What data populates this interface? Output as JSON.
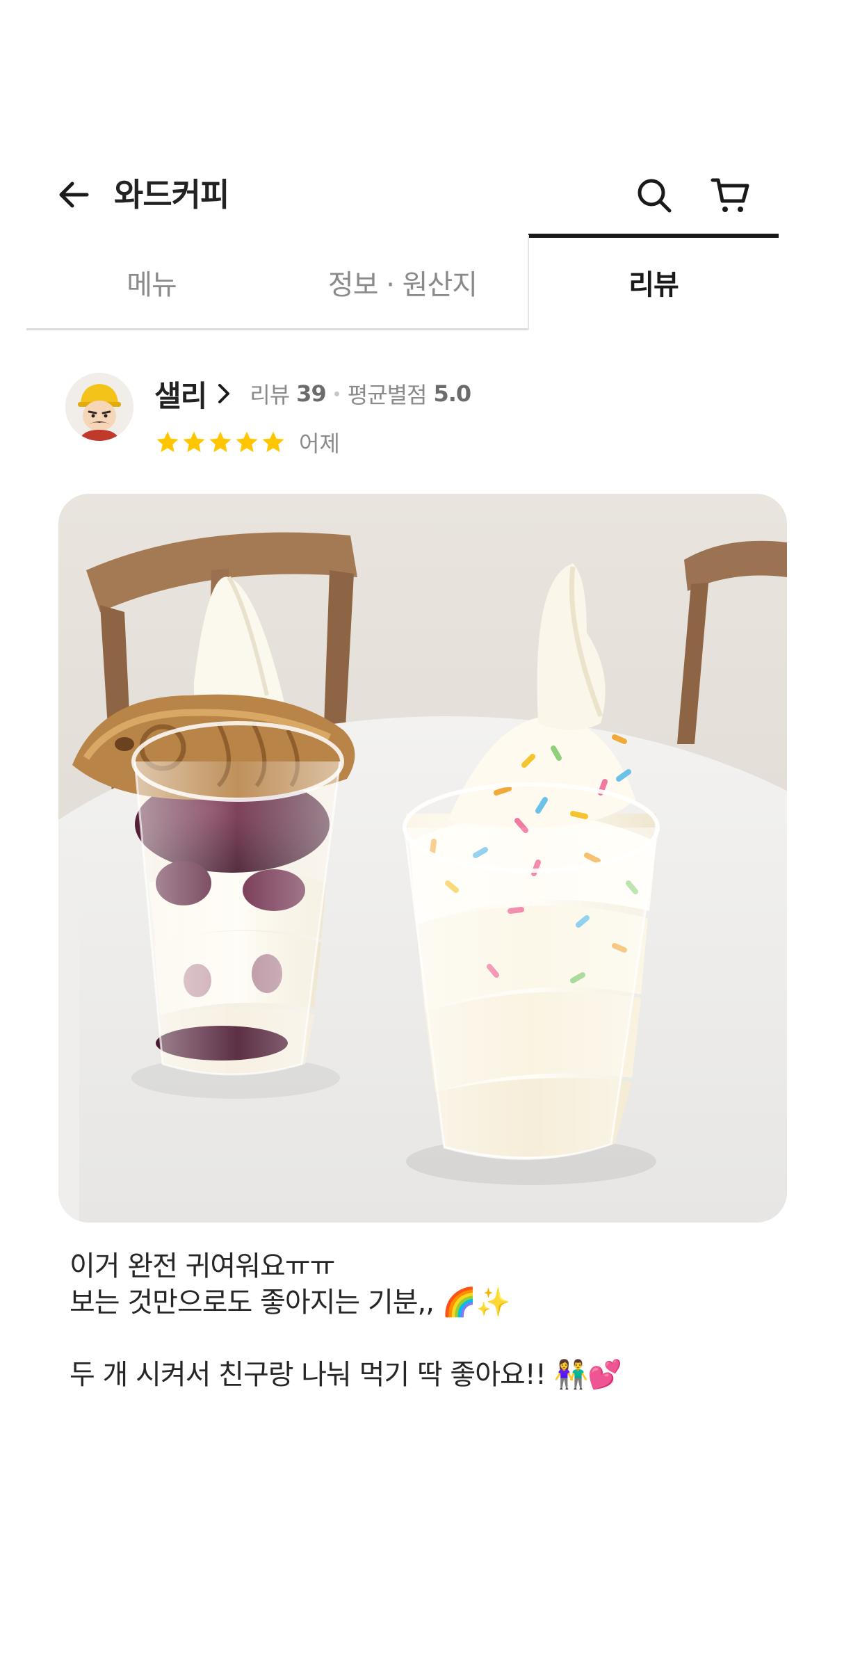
{
  "header": {
    "store_name": "와드커피",
    "back_icon": "arrow-left-icon",
    "search_icon": "search-icon",
    "cart_icon": "cart-icon"
  },
  "tabs": [
    {
      "label": "메뉴",
      "active": false
    },
    {
      "label": "정보 · 원산지",
      "active": false
    },
    {
      "label": "리뷰",
      "active": true
    }
  ],
  "review": {
    "reviewer_name": "샐리",
    "review_count_label": "리뷰",
    "review_count": "39",
    "avg_rating_label": "평균별점",
    "avg_rating": "5.0",
    "stars": 5,
    "date": "어제",
    "text_lines": [
      "이거 완전 귀여워요ㅠㅠ",
      "보는 것만으로도 좋아지는 기분,, 🌈✨",
      "",
      "두 개 시켜서 친구랑 나눠 먹기 딱 좋아요!! 👫💕"
    ]
  },
  "colors": {
    "star": "#FFC600",
    "active_tab": "#1A1A1A",
    "inactive_tab": "#8A8A8A"
  }
}
